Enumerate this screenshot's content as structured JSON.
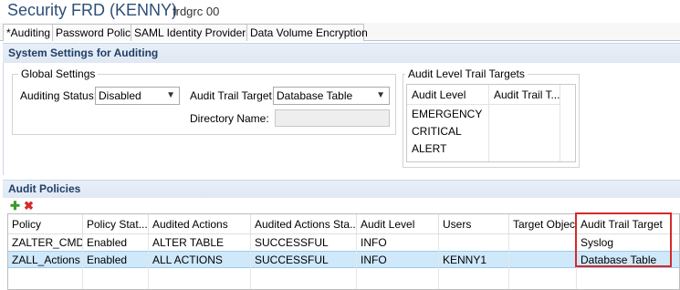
{
  "header": {
    "title": "Security FRD (KENNY)",
    "subtitle": "frdgrc 00"
  },
  "tabs": [
    {
      "label": "*Auditing",
      "active": true
    },
    {
      "label": "Password Policy",
      "active": false
    },
    {
      "label": "SAML Identity Providers",
      "active": false
    },
    {
      "label": "Data Volume Encryption",
      "active": false
    }
  ],
  "system_settings": {
    "title": "System Settings for Auditing",
    "global_settings": {
      "label": "Global Settings",
      "auditing_status_label": "Auditing Status:",
      "auditing_status_value": "Disabled",
      "audit_trail_target_label": "Audit Trail Target:",
      "audit_trail_target_value": "Database Table",
      "directory_name_label": "Directory Name:",
      "directory_name_value": ""
    },
    "level_targets": {
      "label": "Audit Level Trail Targets",
      "columns": [
        "Audit Level",
        "Audit Trail T..."
      ],
      "rows": [
        {
          "level": "EMERGENCY",
          "target": ""
        },
        {
          "level": "CRITICAL",
          "target": ""
        },
        {
          "level": "ALERT",
          "target": ""
        }
      ]
    }
  },
  "audit_policies": {
    "title": "Audit Policies",
    "toolbar": {
      "add_icon": "plus-icon",
      "delete_icon": "x-icon",
      "add_glyph": "✚",
      "delete_glyph": "✖",
      "add_color": "#3a9a2a",
      "delete_color": "#d42a2a"
    },
    "columns": [
      "Policy",
      "Policy Stat...",
      "Audited Actions",
      "Audited Actions Sta...",
      "Audit Level",
      "Users",
      "Target Object",
      "Audit Trail Target"
    ],
    "rows": [
      [
        "ZALTER_CMD",
        "Enabled",
        "ALTER TABLE",
        "SUCCESSFUL",
        "INFO",
        "",
        "",
        "Syslog"
      ],
      [
        "ZALL_Actions",
        "Enabled",
        "ALL ACTIONS",
        "SUCCESSFUL",
        "INFO",
        "KENNY1",
        "",
        "Database Table"
      ]
    ],
    "selected_row": 1,
    "highlight_color": "#d42a2a"
  }
}
